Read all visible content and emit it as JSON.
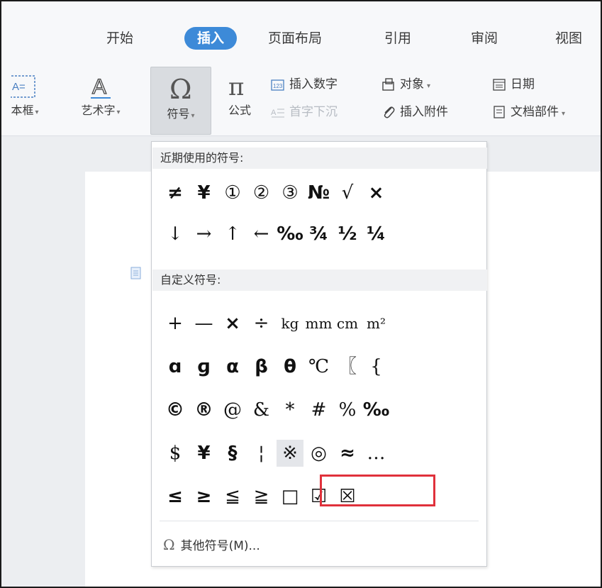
{
  "tabs": [
    {
      "label": "开始",
      "active": false
    },
    {
      "label": "插入",
      "active": true
    },
    {
      "label": "页面布局",
      "active": false
    },
    {
      "label": "引用",
      "active": false
    },
    {
      "label": "审阅",
      "active": false
    },
    {
      "label": "视图",
      "active": false
    }
  ],
  "ribbon": {
    "textbox_label": "本框",
    "wordart_label": "艺术字",
    "symbol_label": "符号",
    "formula_label": "公式",
    "insert_number": "插入数字",
    "drop_cap": "首字下沉",
    "object": "对象",
    "attachment": "插入附件",
    "date": "日期",
    "doc_parts": "文档部件",
    "accent_color": "#3d8ad8"
  },
  "dropdown": {
    "recent_title": "近期使用的符号:",
    "recent_symbols": [
      "≠",
      "¥",
      "①",
      "②",
      "③",
      "№",
      "√",
      "×",
      "↓",
      "→",
      "↑",
      "←",
      "‰",
      "¾",
      "½",
      "¼"
    ],
    "custom_title": "自定义符号:",
    "custom_symbols": [
      "+",
      "—",
      "×",
      "÷",
      "kg",
      "mm",
      "cm",
      "m²",
      "ɑ",
      "ɡ",
      "α",
      "β",
      "θ",
      "℃",
      "〖",
      "{",
      "©",
      "®",
      "@",
      "&",
      "*",
      "#",
      "%",
      "‰",
      "$",
      "¥",
      "§",
      "¦",
      "※",
      "◎",
      "≈",
      "…",
      "≤",
      "≥",
      "≦",
      "≧",
      "□",
      "☑",
      "☒"
    ],
    "more_label": "其他符号(M)...",
    "highlight_color": "#e0313b"
  }
}
